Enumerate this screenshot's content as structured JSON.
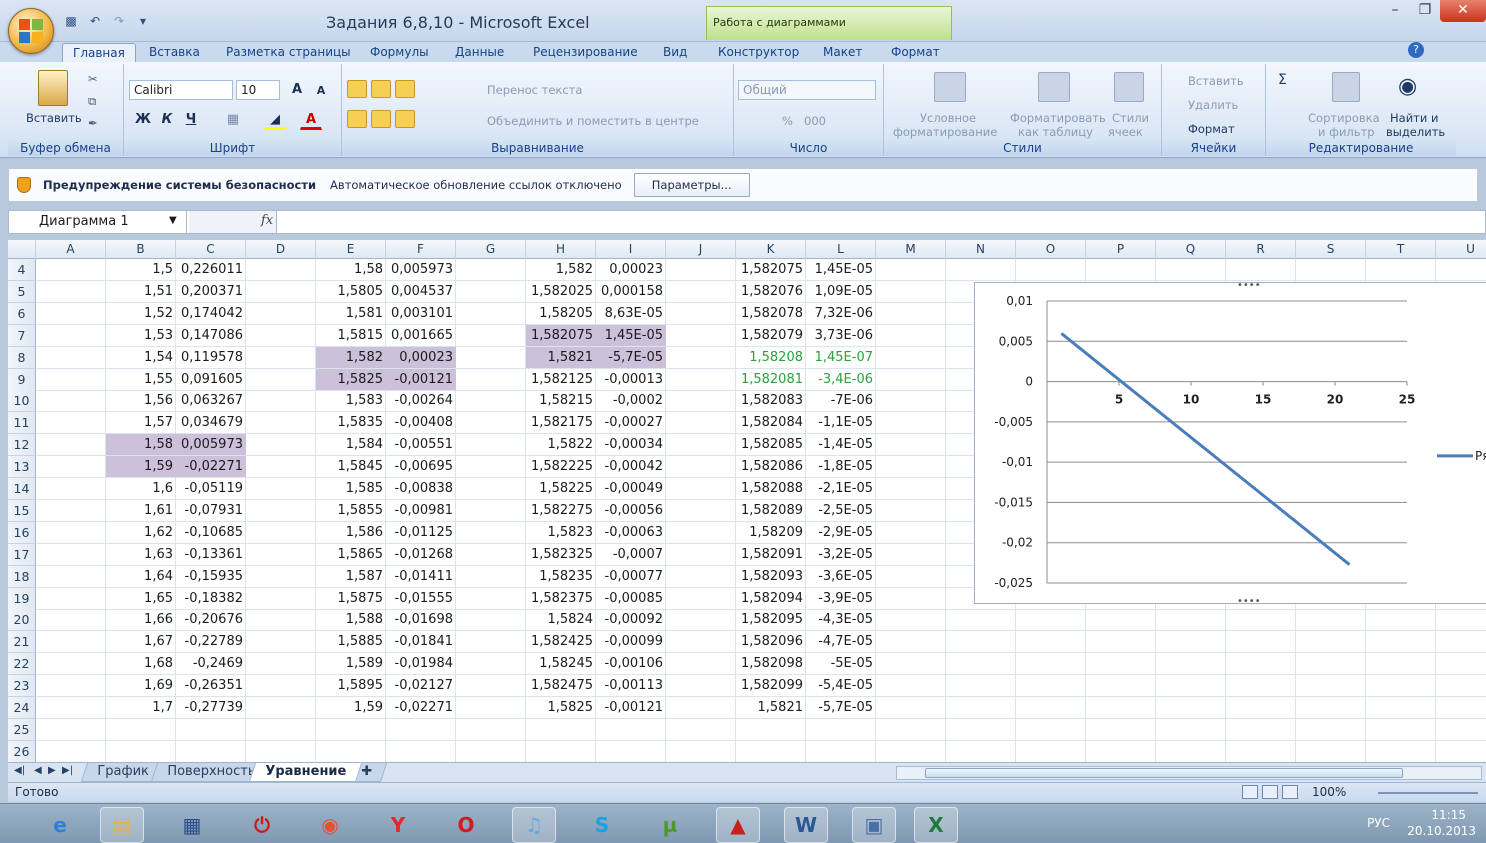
{
  "titlebar": {
    "app_title": "Задания 6,8,10  -  Microsoft Excel",
    "context_tab_title": "Работа с диаграммами"
  },
  "ribbon_tabs": [
    "Главная",
    "Вставка",
    "Разметка страницы",
    "Формулы",
    "Данные",
    "Рецензирование",
    "Вид",
    "Конструктор",
    "Макет",
    "Формат"
  ],
  "ribbon": {
    "clipboard": {
      "paste": "Вставить",
      "label": "Буфер обмена"
    },
    "font": {
      "name": "Calibri",
      "size": "10",
      "bold": "Ж",
      "italic": "К",
      "underline": "Ч",
      "label": "Шрифт"
    },
    "alignment": {
      "wrap": "Перенос текста",
      "merge": "Объединить и поместить в центре",
      "label": "Выравнивание"
    },
    "number": {
      "format": "Общий",
      "label": "Число",
      "percent": "%",
      "thousands": "000"
    },
    "styles": {
      "conditional": "Условное",
      "conditional2": "форматирование",
      "as_table": "Форматировать",
      "as_table2": "как таблицу",
      "cell_styles": "Стили",
      "cell_styles2": "ячеек",
      "label": "Стили"
    },
    "cells": {
      "insert": "Вставить",
      "delete": "Удалить",
      "format": "Формат",
      "label": "Ячейки"
    },
    "editing": {
      "sort": "Сортировка",
      "sort2": "и фильтр",
      "find": "Найти и",
      "find2": "выделить",
      "label": "Редактирование"
    }
  },
  "security_bar": {
    "title": "Предупреждение системы безопасности",
    "message": "Автоматическое обновление ссылок отключено",
    "button": "Параметры..."
  },
  "formula_bar": {
    "name_box": "Диаграмма 1",
    "fx": "fx"
  },
  "columns": [
    "A",
    "B",
    "C",
    "D",
    "E",
    "F",
    "G",
    "H",
    "I",
    "J",
    "K",
    "L",
    "M",
    "N",
    "O",
    "P",
    "Q",
    "R",
    "S",
    "T",
    "U"
  ],
  "rows": [
    {
      "n": "4",
      "B": "1,5",
      "C": "0,226011",
      "E": "1,58",
      "F": "0,005973",
      "H": "1,582",
      "I": "0,00023",
      "K": "1,582075",
      "L": "1,45E-05"
    },
    {
      "n": "5",
      "B": "1,51",
      "C": "0,200371",
      "E": "1,5805",
      "F": "0,004537",
      "H": "1,582025",
      "I": "0,000158",
      "K": "1,582076",
      "L": "1,09E-05"
    },
    {
      "n": "6",
      "B": "1,52",
      "C": "0,174042",
      "E": "1,581",
      "F": "0,003101",
      "H": "1,58205",
      "I": "8,63E-05",
      "K": "1,582078",
      "L": "7,32E-06"
    },
    {
      "n": "7",
      "B": "1,53",
      "C": "0,147086",
      "E": "1,5815",
      "F": "0,001665",
      "H": "1,582075",
      "I": "1,45E-05",
      "K": "1,582079",
      "L": "3,73E-06"
    },
    {
      "n": "8",
      "B": "1,54",
      "C": "0,119578",
      "E": "1,582",
      "F": "0,00023",
      "H": "1,5821",
      "I": "-5,7E-05",
      "K": "1,58208",
      "L": "1,45E-07"
    },
    {
      "n": "9",
      "B": "1,55",
      "C": "0,091605",
      "E": "1,5825",
      "F": "-0,00121",
      "H": "1,582125",
      "I": "-0,00013",
      "K": "1,582081",
      "L": "-3,4E-06"
    },
    {
      "n": "10",
      "B": "1,56",
      "C": "0,063267",
      "E": "1,583",
      "F": "-0,00264",
      "H": "1,58215",
      "I": "-0,0002",
      "K": "1,582083",
      "L": "-7E-06"
    },
    {
      "n": "11",
      "B": "1,57",
      "C": "0,034679",
      "E": "1,5835",
      "F": "-0,00408",
      "H": "1,582175",
      "I": "-0,00027",
      "K": "1,582084",
      "L": "-1,1E-05"
    },
    {
      "n": "12",
      "B": "1,58",
      "C": "0,005973",
      "E": "1,584",
      "F": "-0,00551",
      "H": "1,5822",
      "I": "-0,00034",
      "K": "1,582085",
      "L": "-1,4E-05"
    },
    {
      "n": "13",
      "B": "1,59",
      "C": "-0,02271",
      "E": "1,5845",
      "F": "-0,00695",
      "H": "1,582225",
      "I": "-0,00042",
      "K": "1,582086",
      "L": "-1,8E-05"
    },
    {
      "n": "14",
      "B": "1,6",
      "C": "-0,05119",
      "E": "1,585",
      "F": "-0,00838",
      "H": "1,58225",
      "I": "-0,00049",
      "K": "1,582088",
      "L": "-2,1E-05"
    },
    {
      "n": "15",
      "B": "1,61",
      "C": "-0,07931",
      "E": "1,5855",
      "F": "-0,00981",
      "H": "1,582275",
      "I": "-0,00056",
      "K": "1,582089",
      "L": "-2,5E-05"
    },
    {
      "n": "16",
      "B": "1,62",
      "C": "-0,10685",
      "E": "1,586",
      "F": "-0,01125",
      "H": "1,5823",
      "I": "-0,00063",
      "K": "1,58209",
      "L": "-2,9E-05"
    },
    {
      "n": "17",
      "B": "1,63",
      "C": "-0,13361",
      "E": "1,5865",
      "F": "-0,01268",
      "H": "1,582325",
      "I": "-0,0007",
      "K": "1,582091",
      "L": "-3,2E-05"
    },
    {
      "n": "18",
      "B": "1,64",
      "C": "-0,15935",
      "E": "1,587",
      "F": "-0,01411",
      "H": "1,58235",
      "I": "-0,00077",
      "K": "1,582093",
      "L": "-3,6E-05"
    },
    {
      "n": "19",
      "B": "1,65",
      "C": "-0,18382",
      "E": "1,5875",
      "F": "-0,01555",
      "H": "1,582375",
      "I": "-0,00085",
      "K": "1,582094",
      "L": "-3,9E-05"
    },
    {
      "n": "20",
      "B": "1,66",
      "C": "-0,20676",
      "E": "1,588",
      "F": "-0,01698",
      "H": "1,5824",
      "I": "-0,00092",
      "K": "1,582095",
      "L": "-4,3E-05"
    },
    {
      "n": "21",
      "B": "1,67",
      "C": "-0,22789",
      "E": "1,5885",
      "F": "-0,01841",
      "H": "1,582425",
      "I": "-0,00099",
      "K": "1,582096",
      "L": "-4,7E-05"
    },
    {
      "n": "22",
      "B": "1,68",
      "C": "-0,2469",
      "E": "1,589",
      "F": "-0,01984",
      "H": "1,58245",
      "I": "-0,00106",
      "K": "1,582098",
      "L": "-5E-05"
    },
    {
      "n": "23",
      "B": "1,69",
      "C": "-0,26351",
      "E": "1,5895",
      "F": "-0,02127",
      "H": "1,582475",
      "I": "-0,00113",
      "K": "1,582099",
      "L": "-5,4E-05"
    },
    {
      "n": "24",
      "B": "1,7",
      "C": "-0,27739",
      "E": "1,59",
      "F": "-0,02271",
      "H": "1,5825",
      "I": "-0,00121",
      "K": "1,5821",
      "L": "-5,7E-05"
    },
    {
      "n": "25"
    },
    {
      "n": "26"
    }
  ],
  "highlighted_cells": [
    "B12",
    "C12",
    "B13",
    "C13",
    "E8",
    "F8",
    "E9",
    "F9",
    "H7",
    "I7",
    "H8",
    "I8"
  ],
  "green_cells": [
    "K8",
    "L8",
    "K9",
    "L9"
  ],
  "chart_data": {
    "type": "line",
    "x": [
      1,
      21
    ],
    "series": [
      {
        "name": "Ряд",
        "values": [
          0.005973,
          -0.02271
        ],
        "color": "#4a7ebb"
      }
    ],
    "xlim": [
      0,
      25
    ],
    "ylim": [
      -0.025,
      0.01
    ],
    "xticks": [
      "0",
      "5",
      "10",
      "15",
      "20",
      "25"
    ],
    "yticks": [
      "0,01",
      "0,005",
      "0",
      "-0,005",
      "-0,01",
      "-0,015",
      "-0,02",
      "-0,025"
    ],
    "legend": "right",
    "grid": true
  },
  "sheet_tabs": [
    "График",
    "Поверхность",
    "Уравнение"
  ],
  "active_sheet": "Уравнение",
  "status": {
    "ready": "Готово",
    "zoom": "100%"
  },
  "taskbar": {
    "lang": "РУС",
    "time": "11:15",
    "date": "20.10.2013"
  }
}
